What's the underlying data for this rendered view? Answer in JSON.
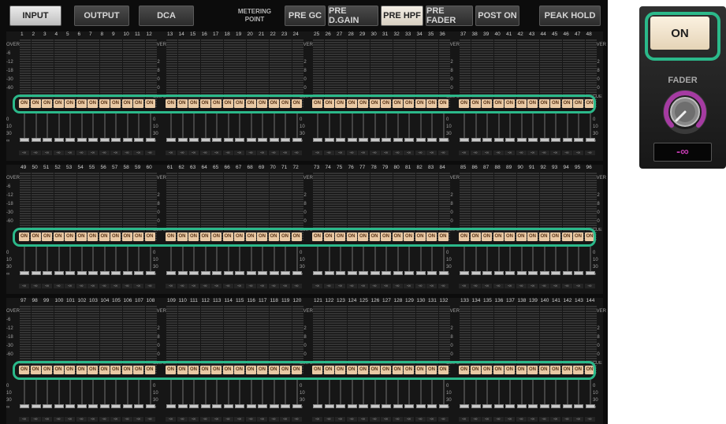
{
  "tabs": {
    "input": "INPUT",
    "output": "OUTPUT",
    "dca": "DCA"
  },
  "metering_point_label": "METERING\nPOINT",
  "metering_buttons": [
    "PRE GC",
    "PRE D.GAIN",
    "PRE HPF",
    "PRE FADER",
    "POST ON"
  ],
  "metering_selected": "PRE HPF",
  "peak_hold_label": "PEAK HOLD",
  "meter_scale": [
    "OVER",
    "-6",
    "-12",
    "-18",
    "-30",
    "-60"
  ],
  "fader_scale": [
    "0",
    "10",
    "30",
    "∞"
  ],
  "cue_label": "CUE B",
  "on_label": "ON",
  "fader_value": "-∞",
  "channel_rows": [
    {
      "groups": [
        {
          "channels": [
            "1",
            "2",
            "3",
            "4",
            "5",
            "6",
            "7",
            "8",
            "9",
            "10",
            "11",
            "12"
          ]
        },
        {
          "channels": [
            "13",
            "14",
            "15",
            "16",
            "17",
            "18",
            "19",
            "20",
            "21",
            "22",
            "23",
            "24"
          ]
        },
        {
          "channels": [
            "25",
            "26",
            "27",
            "28",
            "29",
            "30",
            "31",
            "32",
            "33",
            "34",
            "35",
            "36"
          ]
        },
        {
          "channels": [
            "37",
            "38",
            "39",
            "40",
            "41",
            "42",
            "43",
            "44",
            "45",
            "46",
            "47",
            "48"
          ]
        }
      ]
    },
    {
      "groups": [
        {
          "channels": [
            "49",
            "50",
            "51",
            "52",
            "53",
            "54",
            "55",
            "56",
            "57",
            "58",
            "59",
            "60"
          ]
        },
        {
          "channels": [
            "61",
            "62",
            "63",
            "64",
            "65",
            "66",
            "67",
            "68",
            "69",
            "70",
            "71",
            "72"
          ]
        },
        {
          "channels": [
            "73",
            "74",
            "75",
            "76",
            "77",
            "78",
            "79",
            "80",
            "81",
            "82",
            "83",
            "84"
          ]
        },
        {
          "channels": [
            "85",
            "86",
            "87",
            "88",
            "89",
            "90",
            "91",
            "92",
            "93",
            "94",
            "95",
            "96"
          ]
        }
      ]
    },
    {
      "groups": [
        {
          "channels": [
            "97",
            "98",
            "99",
            "100",
            "101",
            "102",
            "103",
            "104",
            "105",
            "106",
            "107",
            "108"
          ]
        },
        {
          "channels": [
            "109",
            "110",
            "111",
            "112",
            "113",
            "114",
            "115",
            "116",
            "117",
            "118",
            "119",
            "120"
          ]
        },
        {
          "channels": [
            "121",
            "122",
            "123",
            "124",
            "125",
            "126",
            "127",
            "128",
            "129",
            "130",
            "131",
            "132"
          ]
        },
        {
          "channels": [
            "133",
            "134",
            "135",
            "136",
            "137",
            "138",
            "139",
            "140",
            "141",
            "142",
            "143",
            "144"
          ]
        }
      ]
    }
  ],
  "side_panel": {
    "on_button": "ON",
    "fader_label": "FADER",
    "fader_value": "-∞"
  },
  "colors": {
    "highlight": "#2bb98a",
    "on_button": "#e9c9a4",
    "fader_value_text": "#c33ab0",
    "knob_ring": "#a53ba2"
  }
}
